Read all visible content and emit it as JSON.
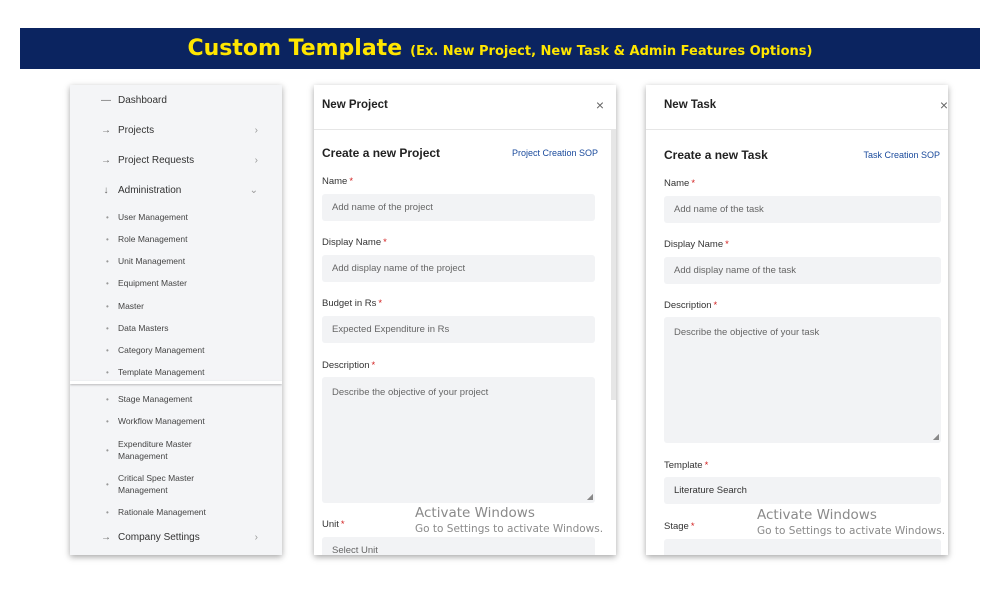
{
  "banner": {
    "title": "Custom Template",
    "subtitle": "(Ex. New Project, New Task & Admin Features Options)"
  },
  "sidebar": {
    "items": [
      {
        "label": "Dashboard",
        "icon": "dash-icon"
      },
      {
        "label": "Projects",
        "icon": "arrow-right-icon"
      },
      {
        "label": "Project Requests",
        "icon": "arrow-right-icon"
      },
      {
        "label": "Administration",
        "icon": "arrow-down-icon"
      }
    ],
    "admin_subitems": [
      "User Management",
      "Role Management",
      "Unit Management",
      "Equipment Master",
      "Master",
      "Data Masters",
      "Category Management",
      "Template Management"
    ],
    "more_subitems": [
      "Stage Management",
      "Workflow Management",
      "Expenditure Master Management",
      "Critical Spec Master Management",
      "Rationale Management"
    ],
    "company_settings": "Company Settings"
  },
  "new_project": {
    "title": "New Project",
    "heading": "Create a new Project",
    "sop_link": "Project Creation SOP",
    "fields": {
      "name_label": "Name",
      "name_placeholder": "Add name of the project",
      "display_label": "Display Name",
      "display_placeholder": "Add display name of the project",
      "budget_label": "Budget in Rs",
      "budget_placeholder": "Expected Expenditure in Rs",
      "description_label": "Description",
      "description_placeholder": "Describe the objective of your project",
      "unit_label": "Unit",
      "unit_placeholder": "Select Unit"
    }
  },
  "new_task": {
    "title": "New Task",
    "heading": "Create a new Task",
    "sop_link": "Task Creation SOP",
    "fields": {
      "name_label": "Name",
      "name_placeholder": "Add name of the task",
      "display_label": "Display Name",
      "display_placeholder": "Add display name of the task",
      "description_label": "Description",
      "description_placeholder": "Describe the objective of your task",
      "template_label": "Template",
      "template_value": "Literature Search",
      "stage_label": "Stage"
    }
  },
  "required_mark": "*",
  "close_glyph": "×",
  "watermark": {
    "line1": "Activate Windows",
    "line2": "Go to Settings to activate Windows."
  },
  "colors": {
    "banner_bg": "#0b2460",
    "banner_text": "#ffe600",
    "link": "#1a4a9c",
    "required": "#d21f1f"
  }
}
